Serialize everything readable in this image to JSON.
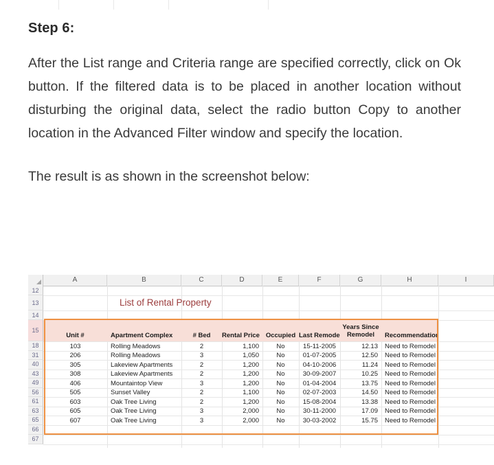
{
  "article": {
    "step_title": "Step 6:",
    "paragraph_1": "After the List range and Criteria range are specified correctly, click on Ok button. If the filtered data is to be placed in another location without disturbing the original data, select the radio button Copy to another location in the Advanced Filter window and specify the location.",
    "paragraph_2": "The result is as shown in the screenshot below:"
  },
  "spreadsheet": {
    "column_letters": [
      "A",
      "B",
      "C",
      "D",
      "E",
      "F",
      "G",
      "H",
      "I"
    ],
    "row_numbers": [
      "12",
      "13",
      "14",
      "15",
      "18",
      "31",
      "40",
      "43",
      "49",
      "56",
      "61",
      "63",
      "65",
      "66",
      "67"
    ],
    "title_cell": "List of Rental Property",
    "title_color": "#9c3d3d",
    "highlight_color": "#ed9042",
    "header_fill": "#f8dfd8",
    "headers": [
      "Unit #",
      "Apartment Complex",
      "# Bed",
      "Rental Price",
      "Occupied",
      "Last Remodel",
      "Years Since Remodel",
      "Recommendation"
    ],
    "header_years_line1": "Years Since",
    "header_years_line2": "Remodel",
    "rows": [
      {
        "row": "18",
        "unit": "103",
        "complex": "Rolling Meadows",
        "bed": "2",
        "price": "1,100",
        "occupied": "No",
        "last_remodel": "15-11-2005",
        "years_since": "12.13",
        "recommendation": "Need to Remodel"
      },
      {
        "row": "31",
        "unit": "206",
        "complex": "Rolling Meadows",
        "bed": "3",
        "price": "1,050",
        "occupied": "No",
        "last_remodel": "01-07-2005",
        "years_since": "12.50",
        "recommendation": "Need to Remodel"
      },
      {
        "row": "40",
        "unit": "305",
        "complex": "Lakeview Apartments",
        "bed": "2",
        "price": "1,200",
        "occupied": "No",
        "last_remodel": "04-10-2006",
        "years_since": "11.24",
        "recommendation": "Need to Remodel"
      },
      {
        "row": "43",
        "unit": "308",
        "complex": "Lakeview Apartments",
        "bed": "2",
        "price": "1,200",
        "occupied": "No",
        "last_remodel": "30-09-2007",
        "years_since": "10.25",
        "recommendation": "Need to Remodel"
      },
      {
        "row": "49",
        "unit": "406",
        "complex": "Mountaintop View",
        "bed": "3",
        "price": "1,200",
        "occupied": "No",
        "last_remodel": "01-04-2004",
        "years_since": "13.75",
        "recommendation": "Need to Remodel"
      },
      {
        "row": "56",
        "unit": "505",
        "complex": "Sunset Valley",
        "bed": "2",
        "price": "1,100",
        "occupied": "No",
        "last_remodel": "02-07-2003",
        "years_since": "14.50",
        "recommendation": "Need to Remodel"
      },
      {
        "row": "61",
        "unit": "603",
        "complex": "Oak Tree Living",
        "bed": "2",
        "price": "1,200",
        "occupied": "No",
        "last_remodel": "15-08-2004",
        "years_since": "13.38",
        "recommendation": "Need to Remodel"
      },
      {
        "row": "63",
        "unit": "605",
        "complex": "Oak Tree Living",
        "bed": "3",
        "price": "2,000",
        "occupied": "No",
        "last_remodel": "30-11-2000",
        "years_since": "17.09",
        "recommendation": "Need to Remodel"
      },
      {
        "row": "65",
        "unit": "607",
        "complex": "Oak Tree Living",
        "bed": "3",
        "price": "2,000",
        "occupied": "No",
        "last_remodel": "30-03-2002",
        "years_since": "15.75",
        "recommendation": "Need to Remodel"
      }
    ]
  }
}
